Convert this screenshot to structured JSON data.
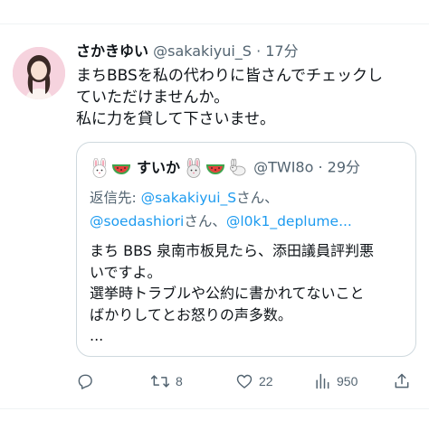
{
  "tweet": {
    "display_name": "さかきゆい",
    "handle": "@sakakiyui_S",
    "separator": "·",
    "time": "17分",
    "text_lines": [
      "まちBBSを私の代わりに皆さんでチェックし",
      "ていただけませんか。",
      "私に力を貸して下さいませ。"
    ]
  },
  "quote": {
    "display_name": "すいか",
    "handle": "@TWI8o",
    "separator": "·",
    "time": "29分",
    "name_emojis": [
      "rabbit-face-icon",
      "watermelon-icon",
      "rabbit-face-icon",
      "watermelon-icon",
      "rabbit-icon"
    ],
    "reply_prefix": "返信先: ",
    "reply_mention_1": "@sakakiyui_S",
    "reply_suffix_1": "さん、",
    "reply_mention_2": "@soedashiori",
    "reply_suffix_2": "さん、",
    "reply_mention_3": "@l0k1_deplume...",
    "body_lines": [
      "まち BBS 泉南市板見たら、添田議員評判悪",
      "いですよ。",
      "選挙時トラブルや公約に書かれてないこと",
      "ばかりしてとお怒りの声多数。",
      "..."
    ]
  },
  "actions": {
    "reply_count": "",
    "retweet_count": "8",
    "like_count": "22",
    "view_count": "950"
  }
}
